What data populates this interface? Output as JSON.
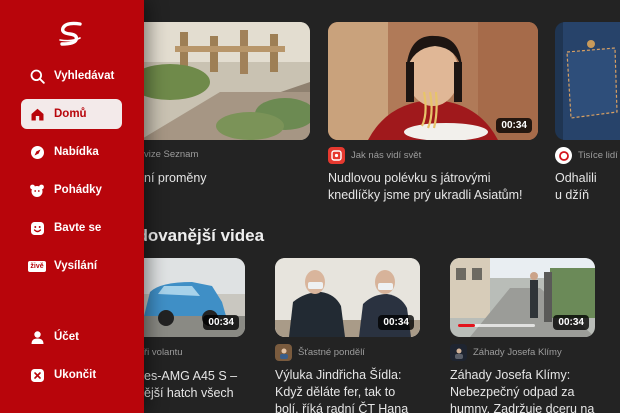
{
  "nav": {
    "items": [
      {
        "label": "Vyhledávat",
        "icon": "search-icon"
      },
      {
        "label": "Domů",
        "icon": "home-icon"
      },
      {
        "label": "Nabídka",
        "icon": "compass-icon"
      },
      {
        "label": "Pohádky",
        "icon": "story-icon"
      },
      {
        "label": "Bavte se",
        "icon": "smile-icon"
      },
      {
        "label": "Vysílání",
        "icon": "live-icon"
      },
      {
        "label": "Účet",
        "icon": "user-icon"
      },
      {
        "label": "Ukončit",
        "icon": "close-icon"
      }
    ],
    "live_badge": "živě",
    "active_item": "Domů"
  },
  "row1": [
    {
      "source": "vize Seznam",
      "title_lines": [
        "ní proměny",
        ""
      ]
    },
    {
      "source": "Jak nás vidí svět",
      "duration": "00:34",
      "title_lines": [
        "Nudlovou polévku s játrovými",
        "knedlíčky jsme prý ukradli Asiatům!"
      ]
    },
    {
      "source": "Tisíce lidí",
      "title_lines": [
        "Odhalili",
        "u džíň"
      ]
    }
  ],
  "section": {
    "title": "edovanější videa"
  },
  "row2": [
    {
      "source": "ři volantu",
      "duration": "00:34",
      "title_lines": [
        "es-AMG A45 S –",
        "ější hatch všech"
      ]
    },
    {
      "source": "Šťastné pondělí",
      "duration": "00:34",
      "title_lines": [
        "Výluka Jindřicha Šídla:",
        "Když děláte fer, tak to",
        "bolí, říká radní ČT Hana"
      ]
    },
    {
      "source": "Záhady Josefa Klímy",
      "duration": "00:34",
      "title_lines": [
        "Záhady Josefa Klímy:",
        "Nebezpečný odpad za",
        "humny. Zadržuje dceru na"
      ]
    }
  ],
  "colors": {
    "brand_red": "#b8050b",
    "background": "#232323",
    "active_pill": "#f3eaea"
  }
}
